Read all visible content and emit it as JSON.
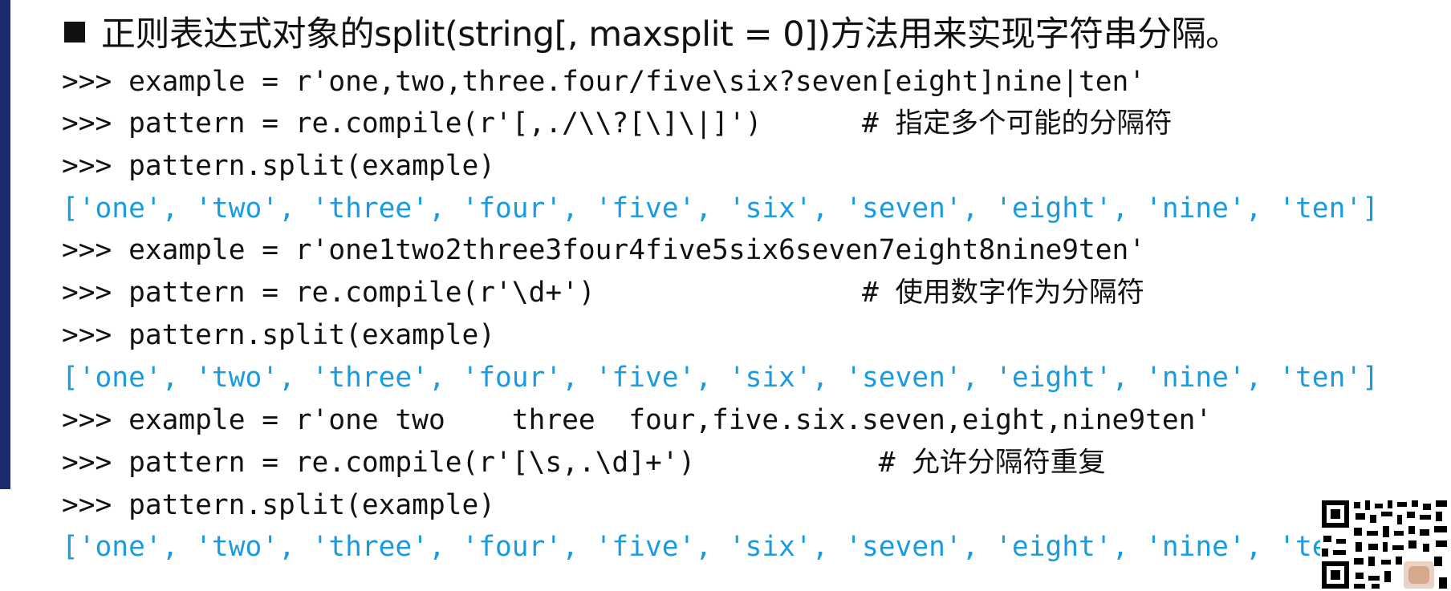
{
  "heading": "正则表达式对象的split(string[, maxsplit = 0])方法用来实现字符串分隔。",
  "lines": [
    {
      "text": ">>> example = r'one,two,three.four/five\\six?seven[eight]nine|ten'",
      "kind": "input"
    },
    {
      "text": ">>> pattern = re.compile(r'[,./\\\\?[\\]\\|]')      # 指定多个可能的分隔符",
      "kind": "input"
    },
    {
      "text": ">>> pattern.split(example)",
      "kind": "input"
    },
    {
      "text": "['one', 'two', 'three', 'four', 'five', 'six', 'seven', 'eight', 'nine', 'ten']",
      "kind": "output"
    },
    {
      "text": ">>> example = r'one1two2three3four4five5six6seven7eight8nine9ten'",
      "kind": "input"
    },
    {
      "text": ">>> pattern = re.compile(r'\\d+')                # 使用数字作为分隔符",
      "kind": "input"
    },
    {
      "text": ">>> pattern.split(example)",
      "kind": "input"
    },
    {
      "text": "['one', 'two', 'three', 'four', 'five', 'six', 'seven', 'eight', 'nine', 'ten']",
      "kind": "output"
    },
    {
      "text": ">>> example = r'one two    three  four,five.six.seven,eight,nine9ten'",
      "kind": "input"
    },
    {
      "text": ">>> pattern = re.compile(r'[\\s,.\\d]+')           # 允许分隔符重复",
      "kind": "input"
    },
    {
      "text": ">>> pattern.split(example)",
      "kind": "input"
    },
    {
      "text": "['one', 'two', 'three', 'four', 'five', 'six', 'seven', 'eight', 'nine', 'ten']",
      "kind": "output"
    }
  ],
  "colors": {
    "input": "#111111",
    "output": "#1a9be0",
    "accent_bar": "#1f2a6e"
  }
}
